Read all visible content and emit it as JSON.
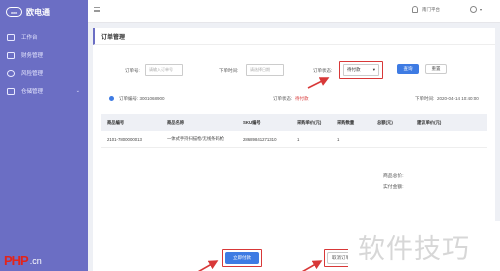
{
  "brand": {
    "logo_mark": "xxx",
    "name": "欧电通"
  },
  "sidebar": {
    "items": [
      {
        "label": "工作台",
        "icon": "monitor-icon"
      },
      {
        "label": "财务管理",
        "icon": "wallet-icon"
      },
      {
        "label": "风险管理",
        "icon": "shield-icon"
      },
      {
        "label": "仓储管理",
        "icon": "box-icon",
        "chevron": "⌄"
      }
    ]
  },
  "topbar": {
    "org": "南门平台",
    "user": "",
    "caret": "▾"
  },
  "page": {
    "title": "订单管理"
  },
  "filters": {
    "order_no_label": "订单号:",
    "order_no_placeholder": "请输入订单号",
    "date_label": "下单时间:",
    "date_placeholder": "请选择日期",
    "status_label": "订单状态:",
    "status_value": "待付款",
    "status_caret": "▾",
    "query_label": "查询",
    "reset_label": "重置"
  },
  "order_info": {
    "order_no_text": "订单编号: 3001068900",
    "status_prefix": "订单状态:",
    "status_value": "待付款",
    "time_label": "下单时间:",
    "time_value": "2020-04-14 10:40:00"
  },
  "table": {
    "headers": [
      "商品编号",
      "商品名称",
      "SKU编号",
      "采购单价(元)",
      "采购数量",
      "总额(元)",
      "建议单价(元)"
    ],
    "rows": [
      [
        "2101-7800000013",
        "一体式手持扫描枪/无线条码枪",
        "28689841271310",
        "1",
        "1",
        "",
        ""
      ]
    ]
  },
  "summary": {
    "line1": "商品总价:",
    "line2": "实付金额:"
  },
  "buttons": {
    "confirm": "立即付款",
    "cancel": "取消订单"
  },
  "watermark": {
    "text": "软件技巧",
    "logo_pp": "PHP",
    "logo_domain": ".cn"
  },
  "colors": {
    "sidebar": "#6b6ec4",
    "primary": "#3e7be3",
    "annotation_red": "#d83838"
  }
}
